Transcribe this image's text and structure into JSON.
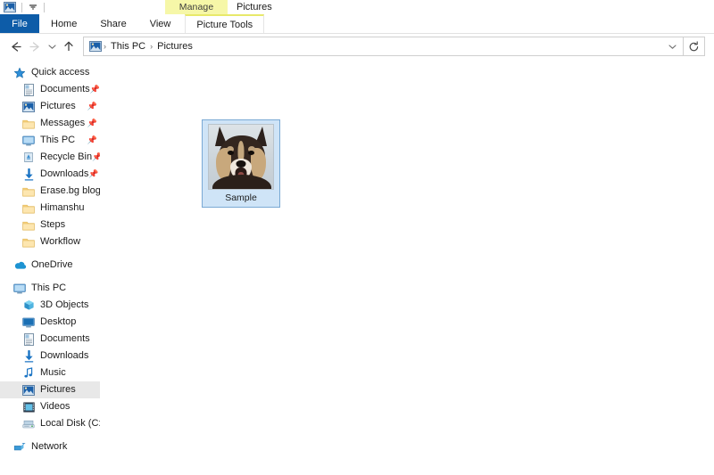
{
  "window": {
    "title": "Pictures",
    "contextual_tab_group": "Picture Tools",
    "contextual_tab_label": "Manage",
    "contextual_color": "#f6f7a8",
    "accent_color": "#0d5ca8"
  },
  "quick_access_toolbar": {
    "icon": "pictures-folder-icon",
    "customize_icon": "chevron-down-icon"
  },
  "ribbon": {
    "tabs": [
      {
        "label": "File",
        "active": true,
        "style": "file"
      },
      {
        "label": "Home",
        "active": false,
        "style": "normal"
      },
      {
        "label": "Share",
        "active": false,
        "style": "normal"
      },
      {
        "label": "View",
        "active": false,
        "style": "normal"
      },
      {
        "label": "Picture Tools",
        "active": true,
        "style": "contextual"
      }
    ]
  },
  "navbar": {
    "back": {
      "icon": "back-arrow-icon",
      "enabled": true
    },
    "forward": {
      "icon": "forward-arrow-icon",
      "enabled": false
    },
    "recent": {
      "icon": "chevron-down-icon",
      "enabled": true
    },
    "up": {
      "icon": "up-arrow-icon",
      "enabled": true
    },
    "address": {
      "icon": "pictures-folder-icon",
      "breadcrumbs": [
        "This PC",
        "Pictures"
      ],
      "separator": "›",
      "dropdown_icon": "chevron-down-icon"
    },
    "refresh": {
      "icon": "refresh-icon",
      "label": "↻"
    }
  },
  "sidebar": {
    "groups": [
      {
        "name": "quick-access",
        "items": [
          {
            "label": "Quick access",
            "icon": "star-icon",
            "level": "root",
            "pinned": false,
            "selected": false
          },
          {
            "label": "Documents",
            "icon": "documents-icon",
            "level": "child",
            "pinned": true,
            "selected": false
          },
          {
            "label": "Pictures",
            "icon": "pictures-icon",
            "level": "child",
            "pinned": true,
            "selected": false
          },
          {
            "label": "Messages",
            "icon": "folder-icon",
            "level": "child",
            "pinned": true,
            "selected": false
          },
          {
            "label": "This PC",
            "icon": "computer-icon",
            "level": "child",
            "pinned": true,
            "selected": false
          },
          {
            "label": "Recycle Bin",
            "icon": "recycle-bin-icon",
            "level": "child",
            "pinned": true,
            "selected": false
          },
          {
            "label": "Downloads",
            "icon": "downloads-icon",
            "level": "child",
            "pinned": true,
            "selected": false
          },
          {
            "label": "Erase.bg blog",
            "icon": "folder-icon",
            "level": "child",
            "pinned": true,
            "pin_clipped": true,
            "selected": false
          },
          {
            "label": "Himanshu",
            "icon": "folder-icon",
            "level": "child",
            "pinned": false,
            "selected": false
          },
          {
            "label": "Steps",
            "icon": "folder-icon",
            "level": "child",
            "pinned": false,
            "selected": false
          },
          {
            "label": "Workflow",
            "icon": "folder-icon",
            "level": "child",
            "pinned": false,
            "selected": false
          }
        ]
      },
      {
        "name": "onedrive",
        "items": [
          {
            "label": "OneDrive",
            "icon": "onedrive-cloud-icon",
            "level": "root",
            "pinned": false,
            "selected": false
          }
        ]
      },
      {
        "name": "this-pc",
        "items": [
          {
            "label": "This PC",
            "icon": "computer-icon",
            "level": "root",
            "pinned": false,
            "selected": false
          },
          {
            "label": "3D Objects",
            "icon": "3d-objects-icon",
            "level": "child",
            "pinned": false,
            "selected": false
          },
          {
            "label": "Desktop",
            "icon": "desktop-icon",
            "level": "child",
            "pinned": false,
            "selected": false
          },
          {
            "label": "Documents",
            "icon": "documents-icon",
            "level": "child",
            "pinned": false,
            "selected": false
          },
          {
            "label": "Downloads",
            "icon": "downloads-icon",
            "level": "child",
            "pinned": false,
            "selected": false
          },
          {
            "label": "Music",
            "icon": "music-note-icon",
            "level": "child",
            "pinned": false,
            "selected": false
          },
          {
            "label": "Pictures",
            "icon": "pictures-icon",
            "level": "child",
            "pinned": false,
            "selected": true
          },
          {
            "label": "Videos",
            "icon": "videos-icon",
            "level": "child",
            "pinned": false,
            "selected": false
          },
          {
            "label": "Local Disk (C:)",
            "icon": "hard-disk-icon",
            "level": "child",
            "pinned": false,
            "selected": false
          }
        ]
      },
      {
        "name": "network",
        "items": [
          {
            "label": "Network",
            "icon": "network-icon",
            "level": "root",
            "pinned": false,
            "selected": false
          }
        ]
      }
    ]
  },
  "content": {
    "items": [
      {
        "label": "Sample",
        "type": "image-file",
        "selected": true,
        "thumbnail": "dog-photo"
      }
    ]
  }
}
